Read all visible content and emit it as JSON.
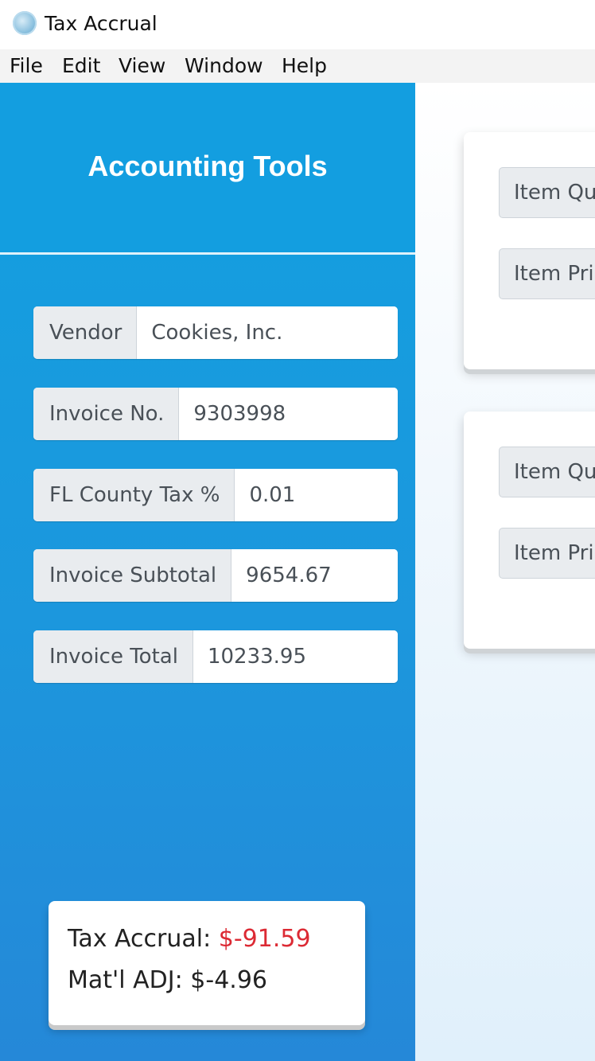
{
  "window": {
    "title": "Tax Accrual",
    "icon": "app-globe-icon"
  },
  "menu": [
    "File",
    "Edit",
    "View",
    "Window",
    "Help"
  ],
  "sidebar": {
    "title": "Accounting Tools",
    "fields": [
      {
        "label": "Vendor",
        "value": "Cookies, Inc."
      },
      {
        "label": "Invoice No.",
        "value": "9303998"
      },
      {
        "label": "FL County Tax %",
        "value": "0.01"
      },
      {
        "label": "Invoice Subtotal",
        "value": "9654.67"
      },
      {
        "label": "Invoice Total",
        "value": "10233.95"
      }
    ],
    "results": {
      "tax_accrual_label": "Tax Accrual:",
      "tax_accrual_value": "$-91.59",
      "matl_adj_label": "Mat'l ADJ:",
      "matl_adj_value": "$-4.96"
    }
  },
  "items": [
    {
      "quantity_label": "Item Qu",
      "price_label": "Item Pri"
    },
    {
      "quantity_label": "Item Qu",
      "price_label": "Item Pri"
    }
  ],
  "colors": {
    "sidebar_blue": "#139ee0",
    "negative_red": "#dc2a34"
  }
}
